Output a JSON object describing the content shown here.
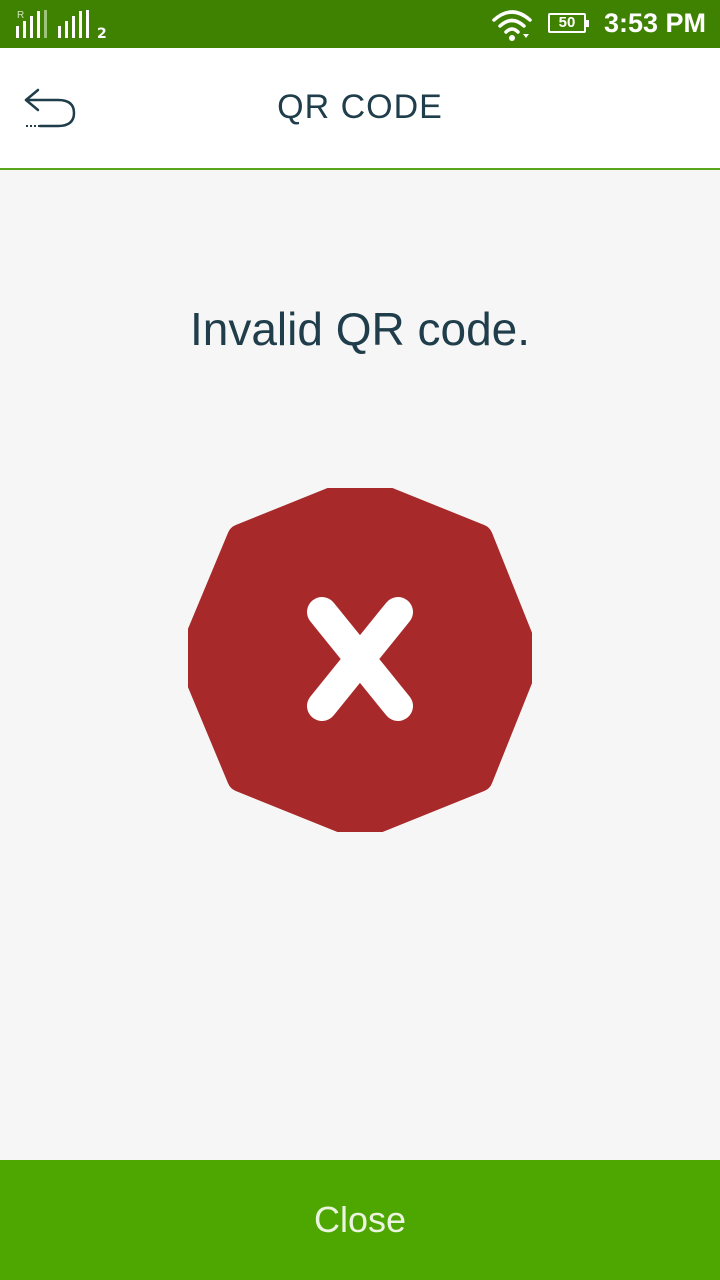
{
  "status_bar": {
    "roaming": "R",
    "sim2": "2",
    "battery": "50",
    "time": "3:53 PM"
  },
  "header": {
    "title": "QR CODE",
    "back_icon": "back-arrow-icon"
  },
  "main": {
    "message": "Invalid QR code.",
    "status_icon": "error-x-icon",
    "error_color": "#a8292a"
  },
  "footer": {
    "close_label": "Close",
    "color": "#4ea600"
  }
}
